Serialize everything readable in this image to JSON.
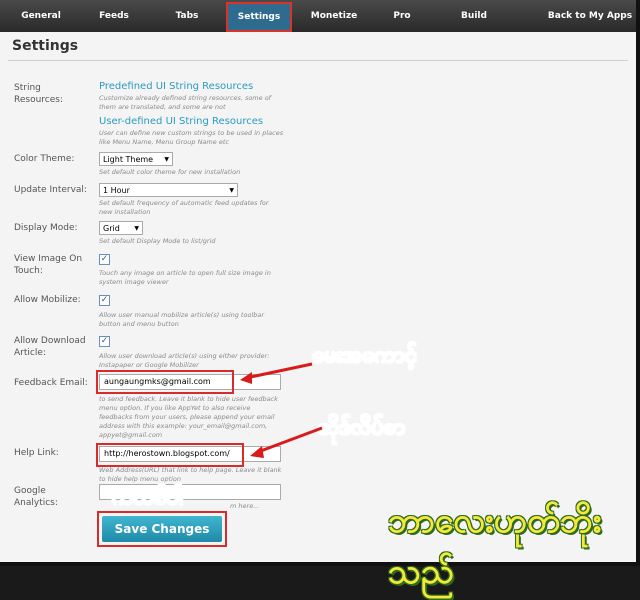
{
  "nav": {
    "tabs": [
      {
        "label": "General"
      },
      {
        "label": "Feeds"
      },
      {
        "label": "Tabs"
      },
      {
        "label": "Settings"
      },
      {
        "label": "Monetize"
      },
      {
        "label": "Pro"
      },
      {
        "label": "Build"
      },
      {
        "label": "Back to My Apps"
      }
    ],
    "active": "Settings"
  },
  "page": {
    "title": "Settings"
  },
  "settings": {
    "string_resources": {
      "label": "String Resources:",
      "predefined_link": "Predefined UI String Resources",
      "predefined_hint": "Customize already defined string resources, some of them are translated, and some are not",
      "userdefined_link": "User-defined UI String Resources",
      "userdefined_hint": "User can define new custom strings to be used in places like Menu Name, Menu Group Name etc"
    },
    "color_theme": {
      "label": "Color Theme:",
      "value": "Light Theme",
      "hint": "Set default color theme for new installation"
    },
    "update_interval": {
      "label": "Update Interval:",
      "value": "1 Hour",
      "hint": "Set default frequency of automatic feed updates for new installation"
    },
    "display_mode": {
      "label": "Display Mode:",
      "value": "Grid",
      "hint": "Set default Display Mode to list/grid"
    },
    "view_image": {
      "label": "View Image On Touch:",
      "checked": true,
      "hint": "Touch any image on article to open full size image in system image viewer"
    },
    "allow_mobilize": {
      "label": "Allow Mobilize:",
      "checked": true,
      "hint": "Allow user manual mobilize article(s) using toolbar button and menu button"
    },
    "allow_download": {
      "label": "Allow Download Article:",
      "checked": true,
      "hint": "Allow user download article(s) using either provider: Instapaper or Google Mobilizer"
    },
    "feedback_email": {
      "label": "Feedback Email:",
      "value": "aungaungmks@gmail.com",
      "hint": "to send feedback. Leave it blank to hide user feedback menu option. If you like AppYet to also receive feedbacks from your users, please append your email address with this example: your_email@gmail.com, appyet@gmail.com"
    },
    "help_link": {
      "label": "Help Link:",
      "value": "http://herostown.blogspot.com/",
      "hint": "Web Address(URL) that link to help page. Leave it blank to hide help menu option"
    },
    "google_analytics": {
      "label": "Google Analytics:",
      "hint": "m here..."
    },
    "save_button": "Save Changes"
  },
  "annotations": {
    "email_note": "မေးအကောင့်",
    "link_note": "ဆိုဒ်လိပ်စာ",
    "save_note": "ကလစ်ပါ",
    "credit": "ဘာလေးဟုတ်ဘိုးသည်"
  },
  "colors": {
    "accent": "#2a9bbf",
    "annotation": "#d81b1b",
    "nav_bg": "#333333"
  }
}
